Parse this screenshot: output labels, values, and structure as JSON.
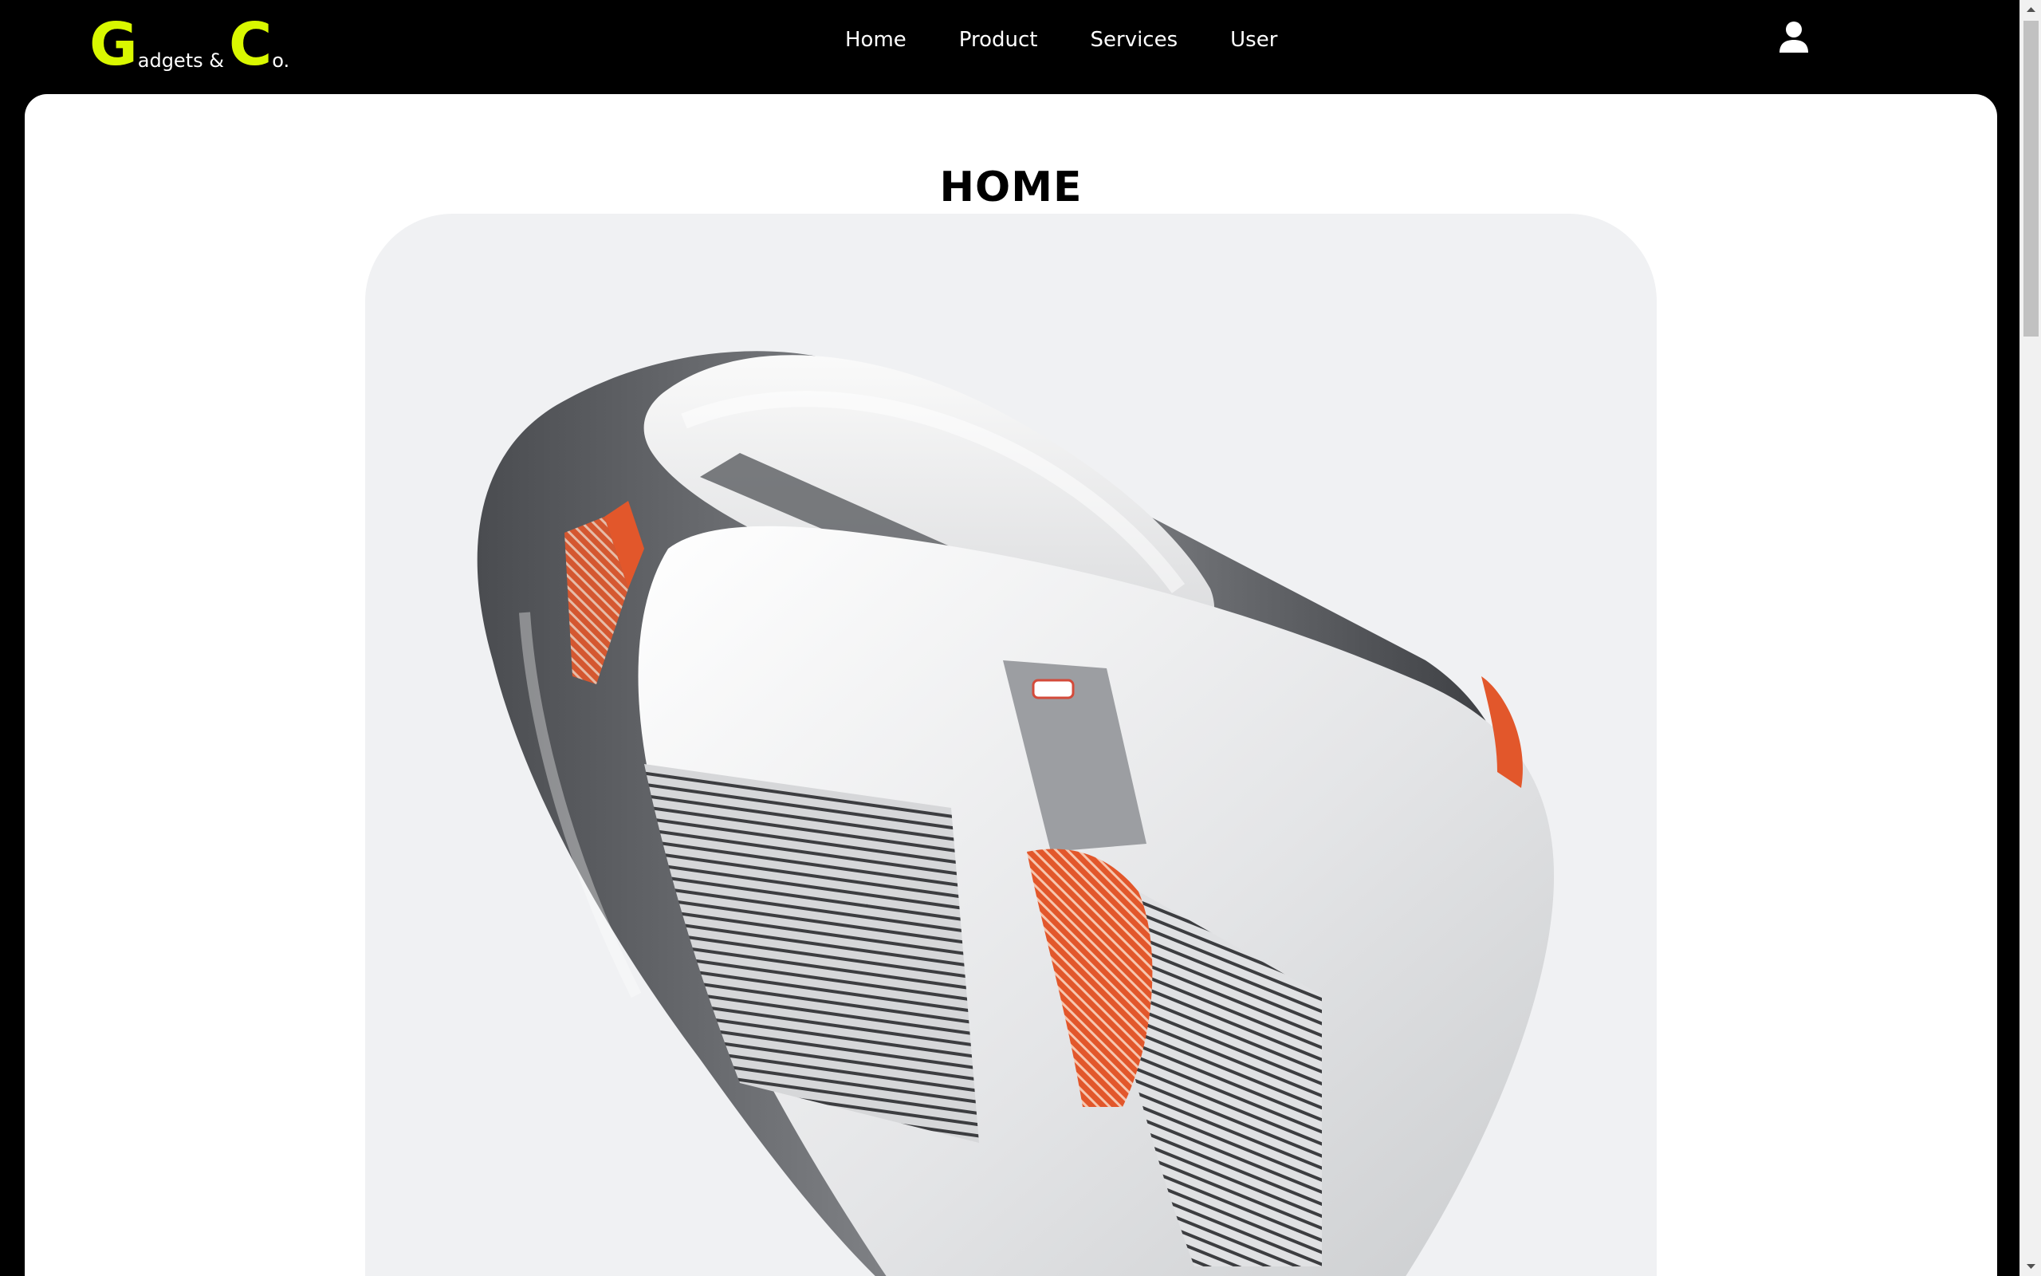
{
  "header": {
    "logo": {
      "letter_g": "G",
      "text_adgets": "adgets &",
      "letter_c": "C",
      "text_o": "o."
    },
    "nav": [
      {
        "label": "Home"
      },
      {
        "label": "Product"
      },
      {
        "label": "Services"
      },
      {
        "label": "User"
      }
    ],
    "user_icon": "user-icon"
  },
  "main": {
    "title": "HOME",
    "hero_image": "computer-mouse-photo"
  },
  "colors": {
    "background": "#000000",
    "accent": "#d9f800",
    "card": "#ffffff",
    "hero_bg": "#f0f1f3",
    "mouse_accent": "#e2572b"
  }
}
